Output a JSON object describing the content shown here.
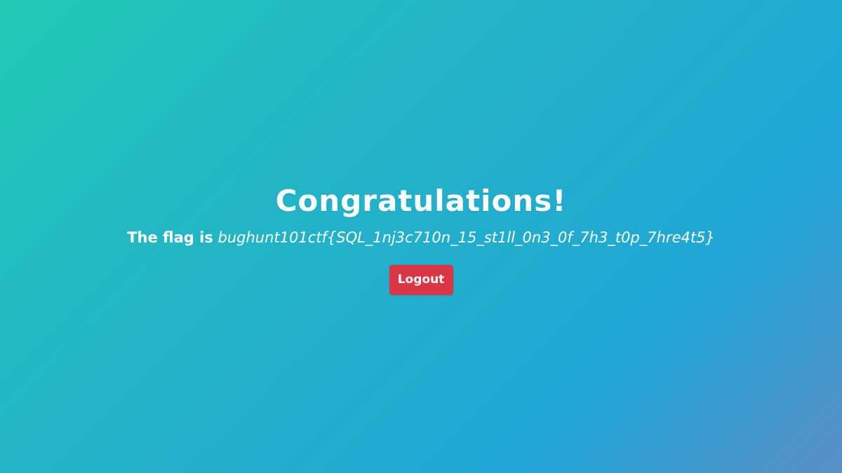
{
  "main": {
    "title": "Congratulations!",
    "flag_label": "The flag is",
    "flag_value": "bughunt101ctf{SQL_1nj3c710n_15_st1ll_0n3_0f_7h3_t0p_7hre4t5}",
    "logout_label": "Logout"
  },
  "colors": {
    "gradient_start": "#22c8b4",
    "gradient_end": "#5a8ec6",
    "logout_button": "#dc3545",
    "text": "#ffffff"
  }
}
